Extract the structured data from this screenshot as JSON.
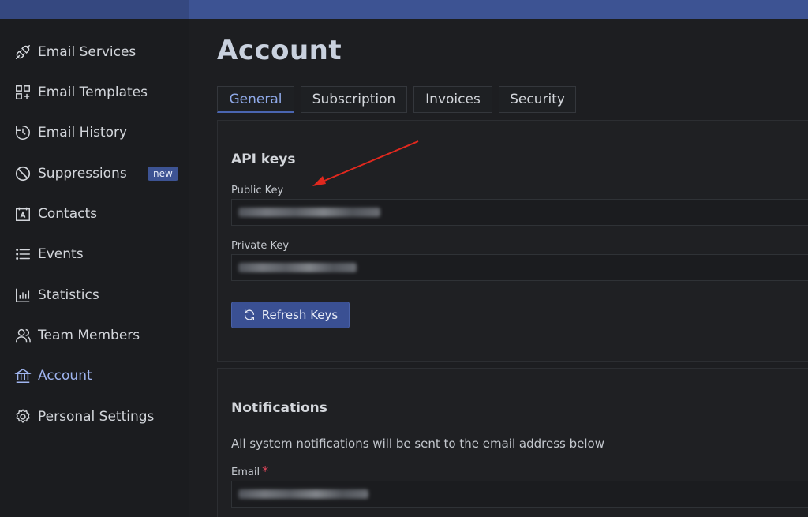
{
  "sidebar": {
    "items": [
      {
        "label": "Email Services",
        "icon": "plug-icon"
      },
      {
        "label": "Email Templates",
        "icon": "templates-icon"
      },
      {
        "label": "Email History",
        "icon": "history-icon"
      },
      {
        "label": "Suppressions",
        "icon": "ban-icon",
        "badge": "new"
      },
      {
        "label": "Contacts",
        "icon": "contacts-icon"
      },
      {
        "label": "Events",
        "icon": "list-icon"
      },
      {
        "label": "Statistics",
        "icon": "chart-icon"
      },
      {
        "label": "Team Members",
        "icon": "team-icon"
      },
      {
        "label": "Account",
        "icon": "bank-icon",
        "active": true
      },
      {
        "label": "Personal Settings",
        "icon": "gear-icon"
      }
    ]
  },
  "main": {
    "title": "Account",
    "tabs": [
      {
        "label": "General",
        "active": true
      },
      {
        "label": "Subscription"
      },
      {
        "label": "Invoices"
      },
      {
        "label": "Security"
      }
    ],
    "api_keys": {
      "title": "API keys",
      "public_key_label": "Public Key",
      "private_key_label": "Private Key",
      "refresh_button": "Refresh Keys"
    },
    "notifications": {
      "title": "Notifications",
      "description": "All system notifications will be sent to the email address below",
      "email_label": "Email",
      "required_mark": "*"
    }
  },
  "colors": {
    "accent": "#3d5393",
    "active_text": "#9fb4ef",
    "annotation_arrow": "#e0281e",
    "required": "#e0455a"
  }
}
